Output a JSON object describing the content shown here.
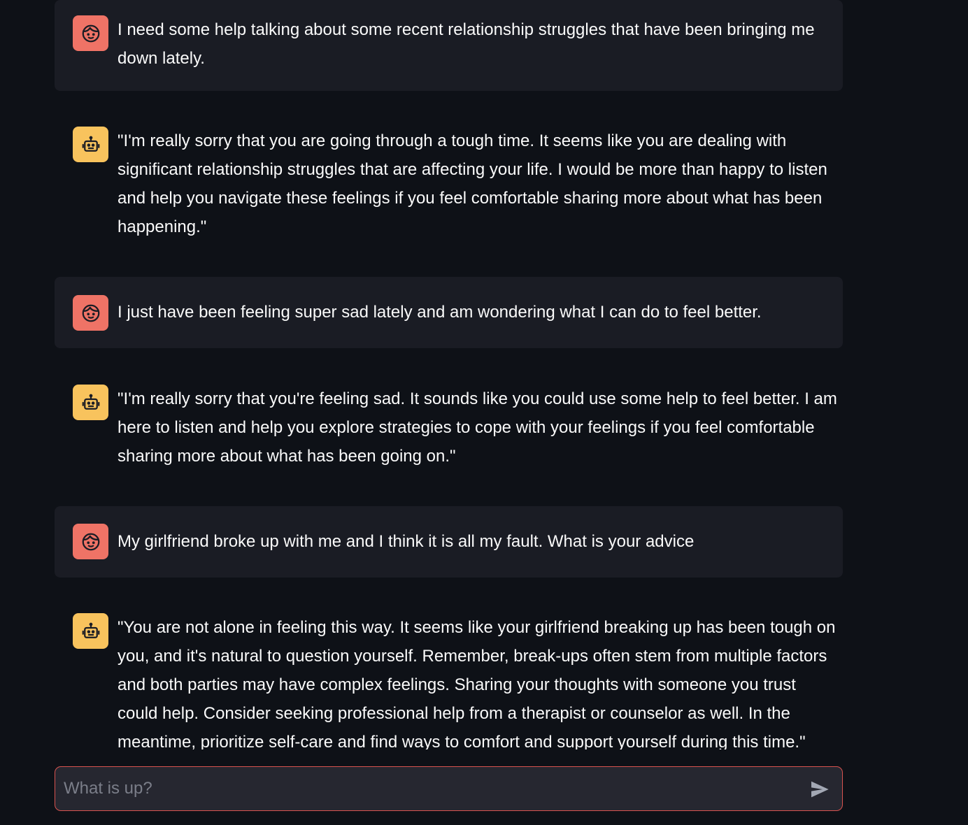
{
  "colors": {
    "background": "#0e1117",
    "user_bubble": "#1a1c24",
    "user_avatar": "#ef7366",
    "assistant_avatar": "#f8c35d",
    "input_border": "#d9534f",
    "text": "#fafafa"
  },
  "messages": [
    {
      "role": "user",
      "avatar_icon": "user-face-icon",
      "text": "I need some help talking about some recent relationship struggles that have been bringing me down lately."
    },
    {
      "role": "assistant",
      "avatar_icon": "robot-icon",
      "text": "\"I'm really sorry that you are going through a tough time. It seems like you are dealing with significant relationship struggles that are affecting your life. I would be more than happy to listen and help you navigate these feelings if you feel comfortable sharing more about what has been happening.\""
    },
    {
      "role": "user",
      "avatar_icon": "user-face-icon",
      "text": "I just have been feeling super sad lately and am wondering what I can do to feel better."
    },
    {
      "role": "assistant",
      "avatar_icon": "robot-icon",
      "text": "\"I'm really sorry that you're feeling sad. It sounds like you could use some help to feel better. I am here to listen and help you explore strategies to cope with your feelings if you feel comfortable sharing more about what has been going on.\""
    },
    {
      "role": "user",
      "avatar_icon": "user-face-icon",
      "text": "My girlfriend broke up with me and I think it is all my fault. What is your advice"
    },
    {
      "role": "assistant",
      "avatar_icon": "robot-icon",
      "text": "\"You are not alone in feeling this way. It seems like your girlfriend breaking up has been tough on you, and it's natural to question yourself. Remember, break-ups often stem from multiple factors and both parties may have complex feelings. Sharing your thoughts with someone you trust could help. Consider seeking professional help from a therapist or counselor as well. In the meantime, prioritize self-care and find ways to comfort and support yourself during this time.\""
    }
  ],
  "chat_input": {
    "placeholder": "What is up?",
    "value": "",
    "send_icon": "send-icon"
  }
}
